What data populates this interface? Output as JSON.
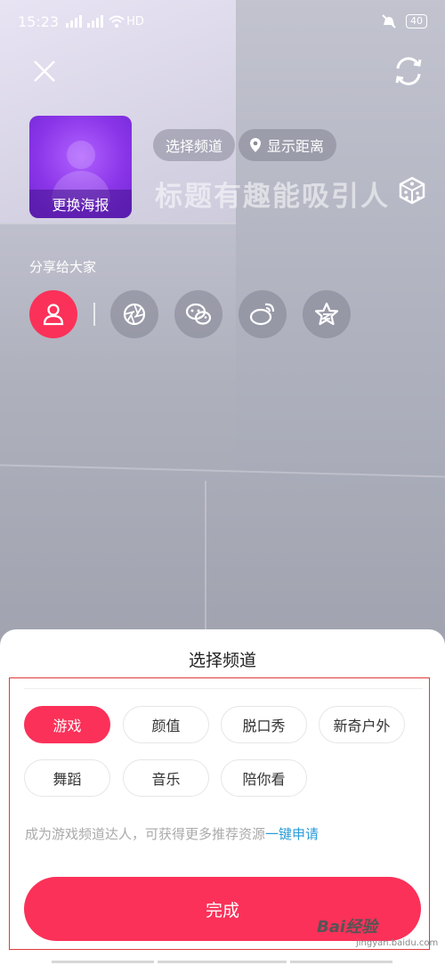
{
  "status_bar": {
    "time": "15:23",
    "network": "HD",
    "battery": "40"
  },
  "poster": {
    "label": "更换海报"
  },
  "chips": {
    "channel": "选择频道",
    "distance": "显示距离"
  },
  "title_placeholder": "标题有趣能吸引人",
  "share": {
    "label": "分享给大家",
    "items": [
      "friends-icon",
      "moments-icon",
      "wechat-icon",
      "weibo-icon",
      "qzone-icon"
    ]
  },
  "sheet": {
    "title": "选择频道",
    "channels": [
      "游戏",
      "颜值",
      "脱口秀",
      "新奇户外",
      "舞蹈",
      "音乐",
      "陪你看"
    ],
    "selected": "游戏",
    "hint_prefix": "成为游戏频道达人，可获得更多推荐资源",
    "hint_link": "一键申请",
    "done": "完成"
  },
  "watermark": {
    "brand": "Bai经验",
    "url": "jingyan.baidu.com"
  },
  "colors": {
    "accent": "#fb3159",
    "link": "#2a9bd8",
    "poster": "#8a35e8"
  }
}
